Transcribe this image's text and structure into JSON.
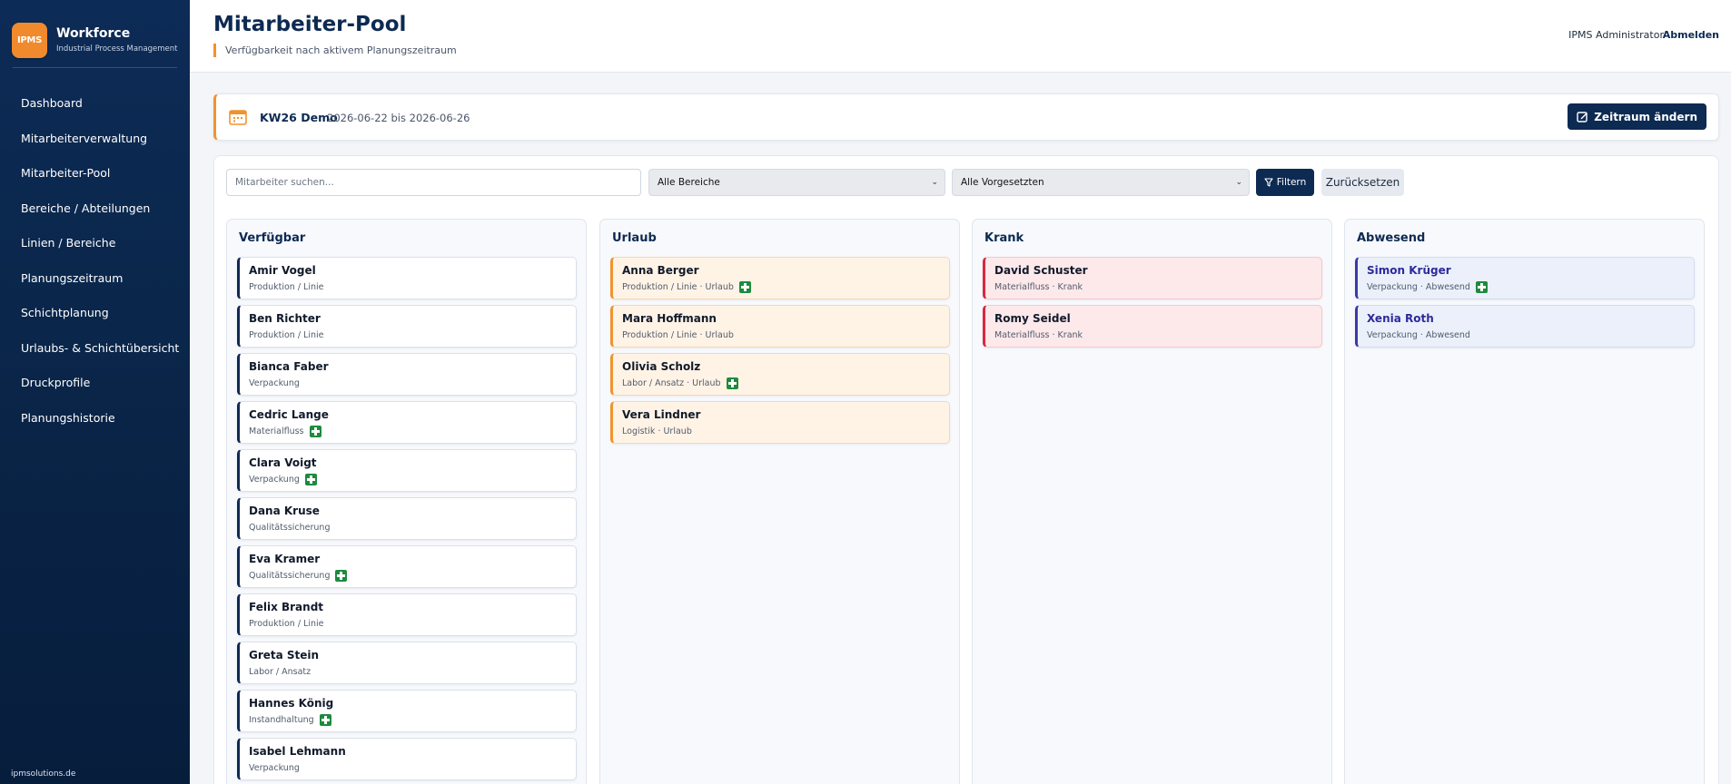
{
  "brand": {
    "logo": "IPMS",
    "title": "Workforce",
    "subtitle": "Industrial Process Management"
  },
  "nav": [
    "Dashboard",
    "Mitarbeiterverwaltung",
    "Mitarbeiter-Pool",
    "Bereiche / Abteilungen",
    "Linien / Bereiche",
    "Planungszeitraum",
    "Schichtplanung",
    "Urlaubs- & Schichtübersicht",
    "Druckprofile",
    "Planungshistorie"
  ],
  "footer": "ipmsolutions.de",
  "header": {
    "title": "Mitarbeiter-Pool",
    "subtitle": "Verfügbarkeit nach aktivem Planungszeitraum",
    "user": "IPMS Administrator",
    "logout": "Abmelden"
  },
  "period": {
    "name": "KW26 Demo",
    "range": "2026-06-22 bis 2026-06-26",
    "change_label": "Zeitraum ändern"
  },
  "filters": {
    "search_placeholder": "Mitarbeiter suchen...",
    "area_selected": "Alle Bereiche",
    "supervisor_selected": "Alle Vorgesetzten",
    "filter_label": "Filtern",
    "reset_label": "Zurücksetzen"
  },
  "columns": [
    {
      "title": "Verfügbar",
      "variant": "verfuegbar",
      "cards": [
        {
          "name": "Amir Vogel",
          "meta": "Produktion / Linie",
          "first_aid": false
        },
        {
          "name": "Ben Richter",
          "meta": "Produktion / Linie",
          "first_aid": false
        },
        {
          "name": "Bianca Faber",
          "meta": "Verpackung",
          "first_aid": false
        },
        {
          "name": "Cedric Lange",
          "meta": "Materialfluss",
          "first_aid": true
        },
        {
          "name": "Clara Voigt",
          "meta": "Verpackung",
          "first_aid": true
        },
        {
          "name": "Dana Kruse",
          "meta": "Qualitätssicherung",
          "first_aid": false
        },
        {
          "name": "Eva Kramer",
          "meta": "Qualitätssicherung",
          "first_aid": true
        },
        {
          "name": "Felix Brandt",
          "meta": "Produktion / Linie",
          "first_aid": false
        },
        {
          "name": "Greta Stein",
          "meta": "Labor / Ansatz",
          "first_aid": false
        },
        {
          "name": "Hannes König",
          "meta": "Instandhaltung",
          "first_aid": true
        },
        {
          "name": "Isabel Lehmann",
          "meta": "Verpackung",
          "first_aid": false
        }
      ]
    },
    {
      "title": "Urlaub",
      "variant": "urlaub",
      "cards": [
        {
          "name": "Anna Berger",
          "meta": "Produktion / Linie · Urlaub",
          "first_aid": true
        },
        {
          "name": "Mara Hoffmann",
          "meta": "Produktion / Linie · Urlaub",
          "first_aid": false
        },
        {
          "name": "Olivia Scholz",
          "meta": "Labor / Ansatz · Urlaub",
          "first_aid": true
        },
        {
          "name": "Vera Lindner",
          "meta": "Logistik · Urlaub",
          "first_aid": false
        }
      ]
    },
    {
      "title": "Krank",
      "variant": "krank",
      "cards": [
        {
          "name": "David Schuster",
          "meta": "Materialfluss · Krank",
          "first_aid": false
        },
        {
          "name": "Romy Seidel",
          "meta": "Materialfluss · Krank",
          "first_aid": false
        }
      ]
    },
    {
      "title": "Abwesend",
      "variant": "abwesend",
      "cards": [
        {
          "name": "Simon Krüger",
          "meta": "Verpackung · Abwesend",
          "first_aid": true
        },
        {
          "name": "Xenia Roth",
          "meta": "Verpackung · Abwesend",
          "first_aid": false
        }
      ]
    }
  ],
  "colors": {
    "navy": "#0d2a52",
    "orange": "#f0932e",
    "green": "#1d8a3e",
    "red": "#d8283e",
    "indigo": "#3b3aa8"
  },
  "icons": {
    "calendar": "calendar-icon",
    "edit": "edit-icon",
    "filter": "filter-icon",
    "first_aid": "first-aid-icon"
  }
}
